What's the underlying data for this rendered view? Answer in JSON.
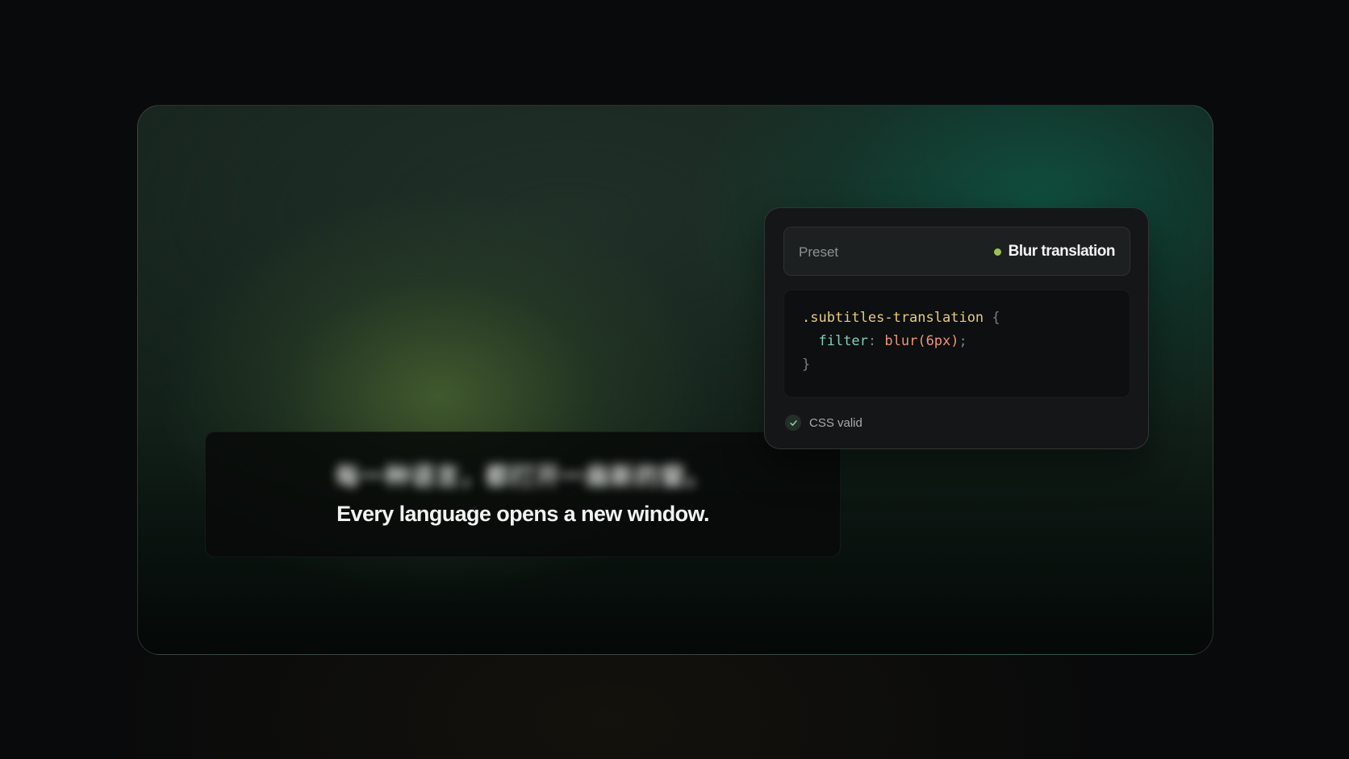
{
  "subtitles": {
    "original": "每一种语言，都打开一扇新的窗。",
    "translation": "Every language opens a new window."
  },
  "preset": {
    "label": "Preset",
    "value": "Blur translation",
    "status_color": "#9fc24b"
  },
  "code": {
    "selector": ".subtitles-translation",
    "open_brace": " {",
    "property": "filter",
    "colon": ": ",
    "value": "blur(6px)",
    "semicolon": ";",
    "close_brace": "}"
  },
  "validation": {
    "icon": "check-icon",
    "label": "CSS valid"
  },
  "colors": {
    "selector": "#e8cd74",
    "property": "#7fd0b6",
    "value": "#ef9472",
    "accent": "#9fc24b"
  }
}
